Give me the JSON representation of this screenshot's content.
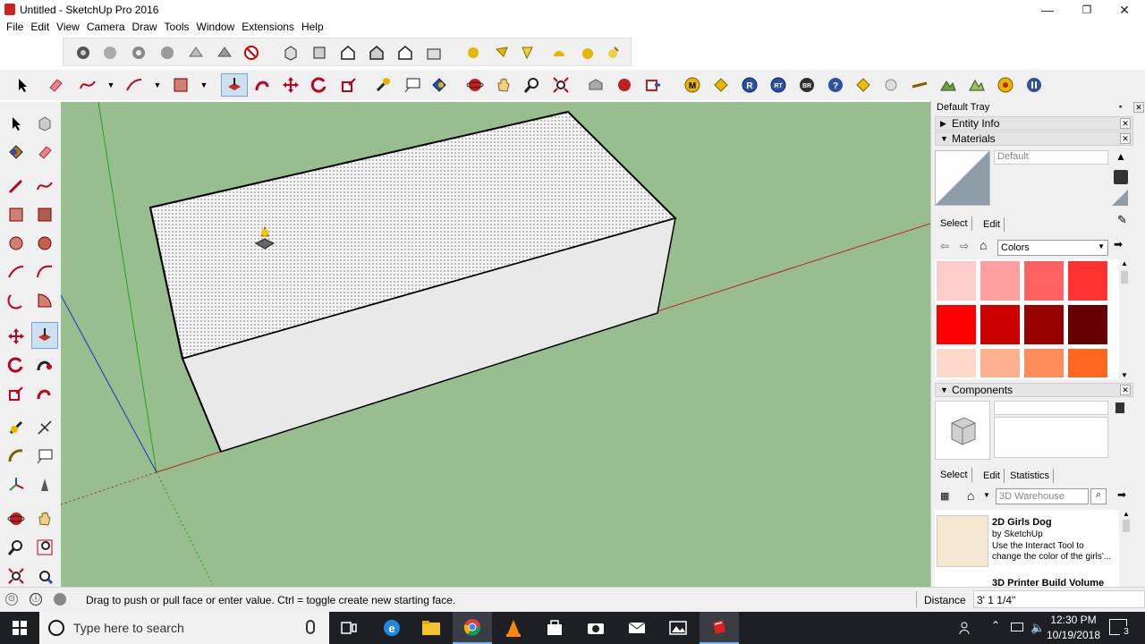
{
  "window": {
    "title": "Untitled - SketchUp Pro 2016",
    "minimize": "—",
    "maximize": "❐",
    "close": "✕"
  },
  "menu": [
    "File",
    "Edit",
    "View",
    "Camera",
    "Draw",
    "Tools",
    "Window",
    "Extensions",
    "Help"
  ],
  "tray": {
    "title": "Default Tray",
    "pin": "📌",
    "entity_info": "Entity Info",
    "materials": {
      "header": "Materials",
      "name_value": "Default",
      "tab_select": "Select",
      "tab_edit": "Edit",
      "collection": "Colors",
      "swatches": [
        "#ffcccc",
        "#ff9f9f",
        "#ff6060",
        "#ff3232",
        "#ff0000",
        "#cc0000",
        "#990000",
        "#660000",
        "#ffd8cc",
        "#ffb08f",
        "#ff8c5a",
        "#ff6620"
      ]
    },
    "components": {
      "header": "Components",
      "tab_select": "Select",
      "tab_edit": "Edit",
      "tab_statistics": "Statistics",
      "search_placeholder": "3D Warehouse",
      "items": [
        {
          "title": "2D Girls Dog",
          "by": "by SketchUp",
          "desc1": "Use the Interact Tool to",
          "desc2": "change the color of the girls'..."
        },
        {
          "title": "3D Printer Build Volume",
          "by": "",
          "desc1": "",
          "desc2": ""
        }
      ]
    }
  },
  "status": {
    "message": "Drag to push or pull face or enter value.  Ctrl = toggle create new starting face.",
    "measure_label": "Distance",
    "measure_value": "3' 1 1/4\""
  },
  "taskbar": {
    "search_placeholder": "Type here to search",
    "time": "12:30 PM",
    "date": "10/19/2018",
    "notification_count": "3"
  },
  "colors": {
    "viewport": "#98be90",
    "taskbar": "#1d1f24",
    "accent": "#d02020"
  }
}
